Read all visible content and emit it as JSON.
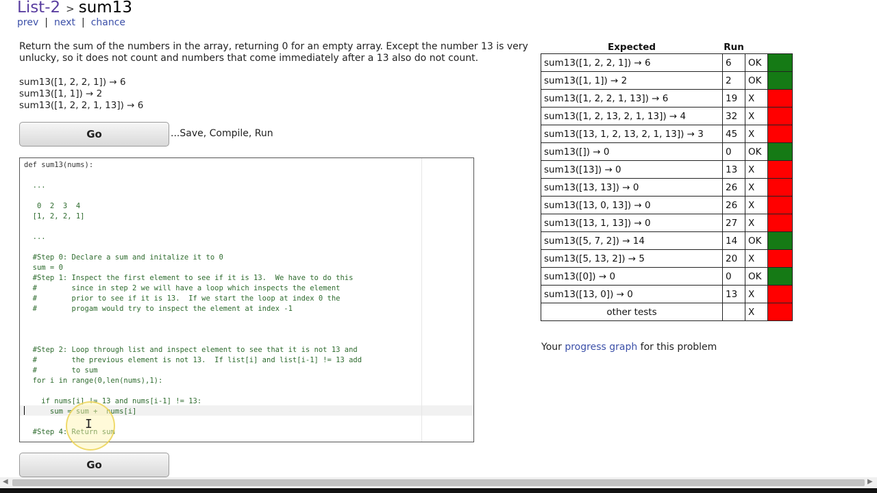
{
  "breadcrumb": {
    "section": "List-2",
    "separator": ">",
    "title": "sum13"
  },
  "nav": {
    "prev": "prev",
    "next": "next",
    "chance": "chance",
    "sep": "|"
  },
  "description": "Return the sum of the numbers in the array, returning 0 for an empty array. Except the number 13 is very unlucky, so it does not count and numbers that come immediately after a 13 also do not count.",
  "examples": [
    "sum13([1, 2, 2, 1]) → 6",
    "sum13([1, 1]) → 2",
    "sum13([1, 2, 2, 1, 13]) → 6"
  ],
  "buttons": {
    "go": "Go",
    "save_label": "...Save, Compile, Run"
  },
  "editor": {
    "lines": [
      "def sum13(nums):",
      "",
      "  ...",
      "",
      "   0  2  3  4",
      "  [1, 2, 2, 1]",
      "",
      "  ...",
      "",
      "  #Step 0: Declare a sum and initalize it to 0",
      "  sum = 0",
      "  #Step 1: Inspect the first element to see if it is 13.  We have to do this",
      "  #        since in step 2 we will have a loop which inspects the element",
      "  #        prior to see if it is 13.  If we start the loop at index 0 the",
      "  #        progam would try to inspect the element at index -1",
      "",
      "",
      "",
      "  #Step 2: Loop through list and inspect element to see that it is not 13 and",
      "  #        the previous element is not 13.  If list[i] and list[i-1] != 13 add",
      "  #        to sum",
      "  for i in range(0,len(nums),1):",
      "",
      "    if nums[i] != 13 and nums[i-1] != 13:",
      "      sum = sum +  nums[i]",
      "",
      "  #Step 4: Return sum",
      ""
    ]
  },
  "results": {
    "headers": {
      "expected": "Expected",
      "run": "Run"
    },
    "rows": [
      {
        "test": "sum13([1, 2, 2, 1]) → 6",
        "run": "6",
        "result": "OK",
        "color": "#157a15"
      },
      {
        "test": "sum13([1, 1]) → 2",
        "run": "2",
        "result": "OK",
        "color": "#157a15"
      },
      {
        "test": "sum13([1, 2, 2, 1, 13]) → 6",
        "run": "19",
        "result": "X",
        "color": "#ff0000"
      },
      {
        "test": "sum13([1, 2, 13, 2, 1, 13]) → 4",
        "run": "32",
        "result": "X",
        "color": "#ff0000"
      },
      {
        "test": "sum13([13, 1, 2, 13, 2, 1, 13]) → 3",
        "run": "45",
        "result": "X",
        "color": "#ff0000"
      },
      {
        "test": "sum13([]) → 0",
        "run": "0",
        "result": "OK",
        "color": "#157a15"
      },
      {
        "test": "sum13([13]) → 0",
        "run": "13",
        "result": "X",
        "color": "#ff0000"
      },
      {
        "test": "sum13([13, 13]) → 0",
        "run": "26",
        "result": "X",
        "color": "#ff0000"
      },
      {
        "test": "sum13([13, 0, 13]) → 0",
        "run": "26",
        "result": "X",
        "color": "#ff0000"
      },
      {
        "test": "sum13([13, 1, 13]) → 0",
        "run": "27",
        "result": "X",
        "color": "#ff0000"
      },
      {
        "test": "sum13([5, 7, 2]) → 14",
        "run": "14",
        "result": "OK",
        "color": "#157a15"
      },
      {
        "test": "sum13([5, 13, 2]) → 5",
        "run": "20",
        "result": "X",
        "color": "#ff0000"
      },
      {
        "test": "sum13([0]) → 0",
        "run": "0",
        "result": "OK",
        "color": "#157a15"
      },
      {
        "test": "sum13([13, 0]) → 0",
        "run": "13",
        "result": "X",
        "color": "#ff0000"
      },
      {
        "test": "other tests",
        "run": "",
        "result": "X",
        "color": "#ff0000"
      }
    ]
  },
  "progress": {
    "prefix": "Your",
    "link": "progress graph",
    "suffix": "for this problem"
  }
}
